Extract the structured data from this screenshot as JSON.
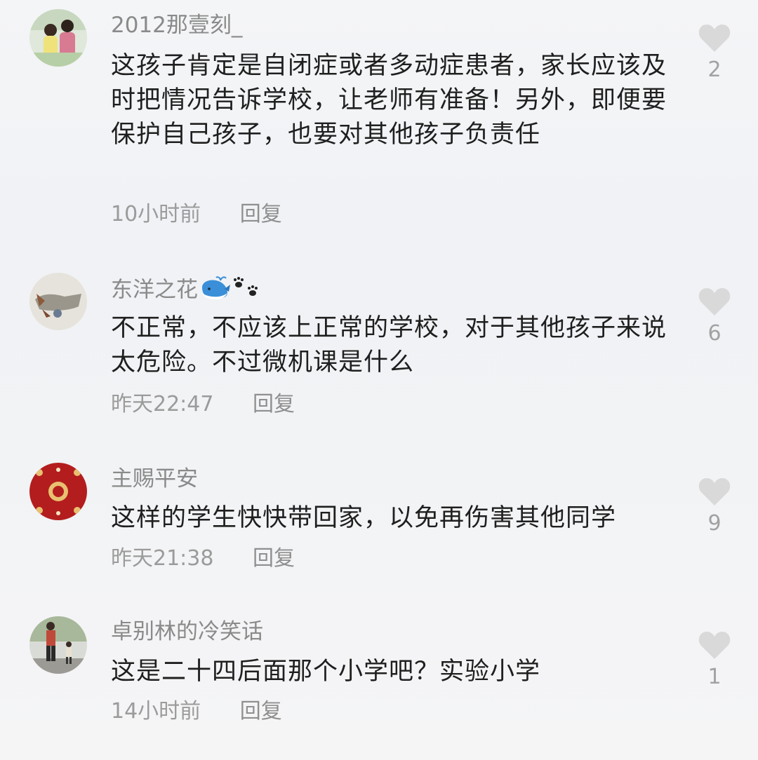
{
  "comments": [
    {
      "username": "2012那壹刻_",
      "text": "这孩子肯定是自闭症或者多动症患者，家长应该及时把情况告诉学校，让老师有准备！另外，即便要保护自己孩子，也要对其他孩子负责任",
      "time": "10小时前",
      "reply": "回复",
      "likes": "2"
    },
    {
      "username": "东洋之花",
      "username_emojis": [
        "whale-emoji",
        "paw-prints-emoji"
      ],
      "text": "不正常，不应该上正常的学校，对于其他孩子来说太危险。不过微机课是什么",
      "time": "昨天22:47",
      "reply": "回复",
      "likes": "6"
    },
    {
      "username": "主赐平安",
      "text": "这样的学生快快带回家，以免再伤害其他同学",
      "time": "昨天21:38",
      "reply": "回复",
      "likes": "9"
    },
    {
      "username": "卓别林的冷笑话",
      "text": "这是二十四后面那个小学吧？实验小学",
      "time": "14小时前",
      "reply": "回复",
      "likes": "1"
    }
  ],
  "icons": {
    "like": "heart-icon"
  },
  "colors": {
    "username": "#8a8a8a",
    "text": "#1f1f1f",
    "meta": "#9b9b9b",
    "heart": "#d9d9d9"
  }
}
